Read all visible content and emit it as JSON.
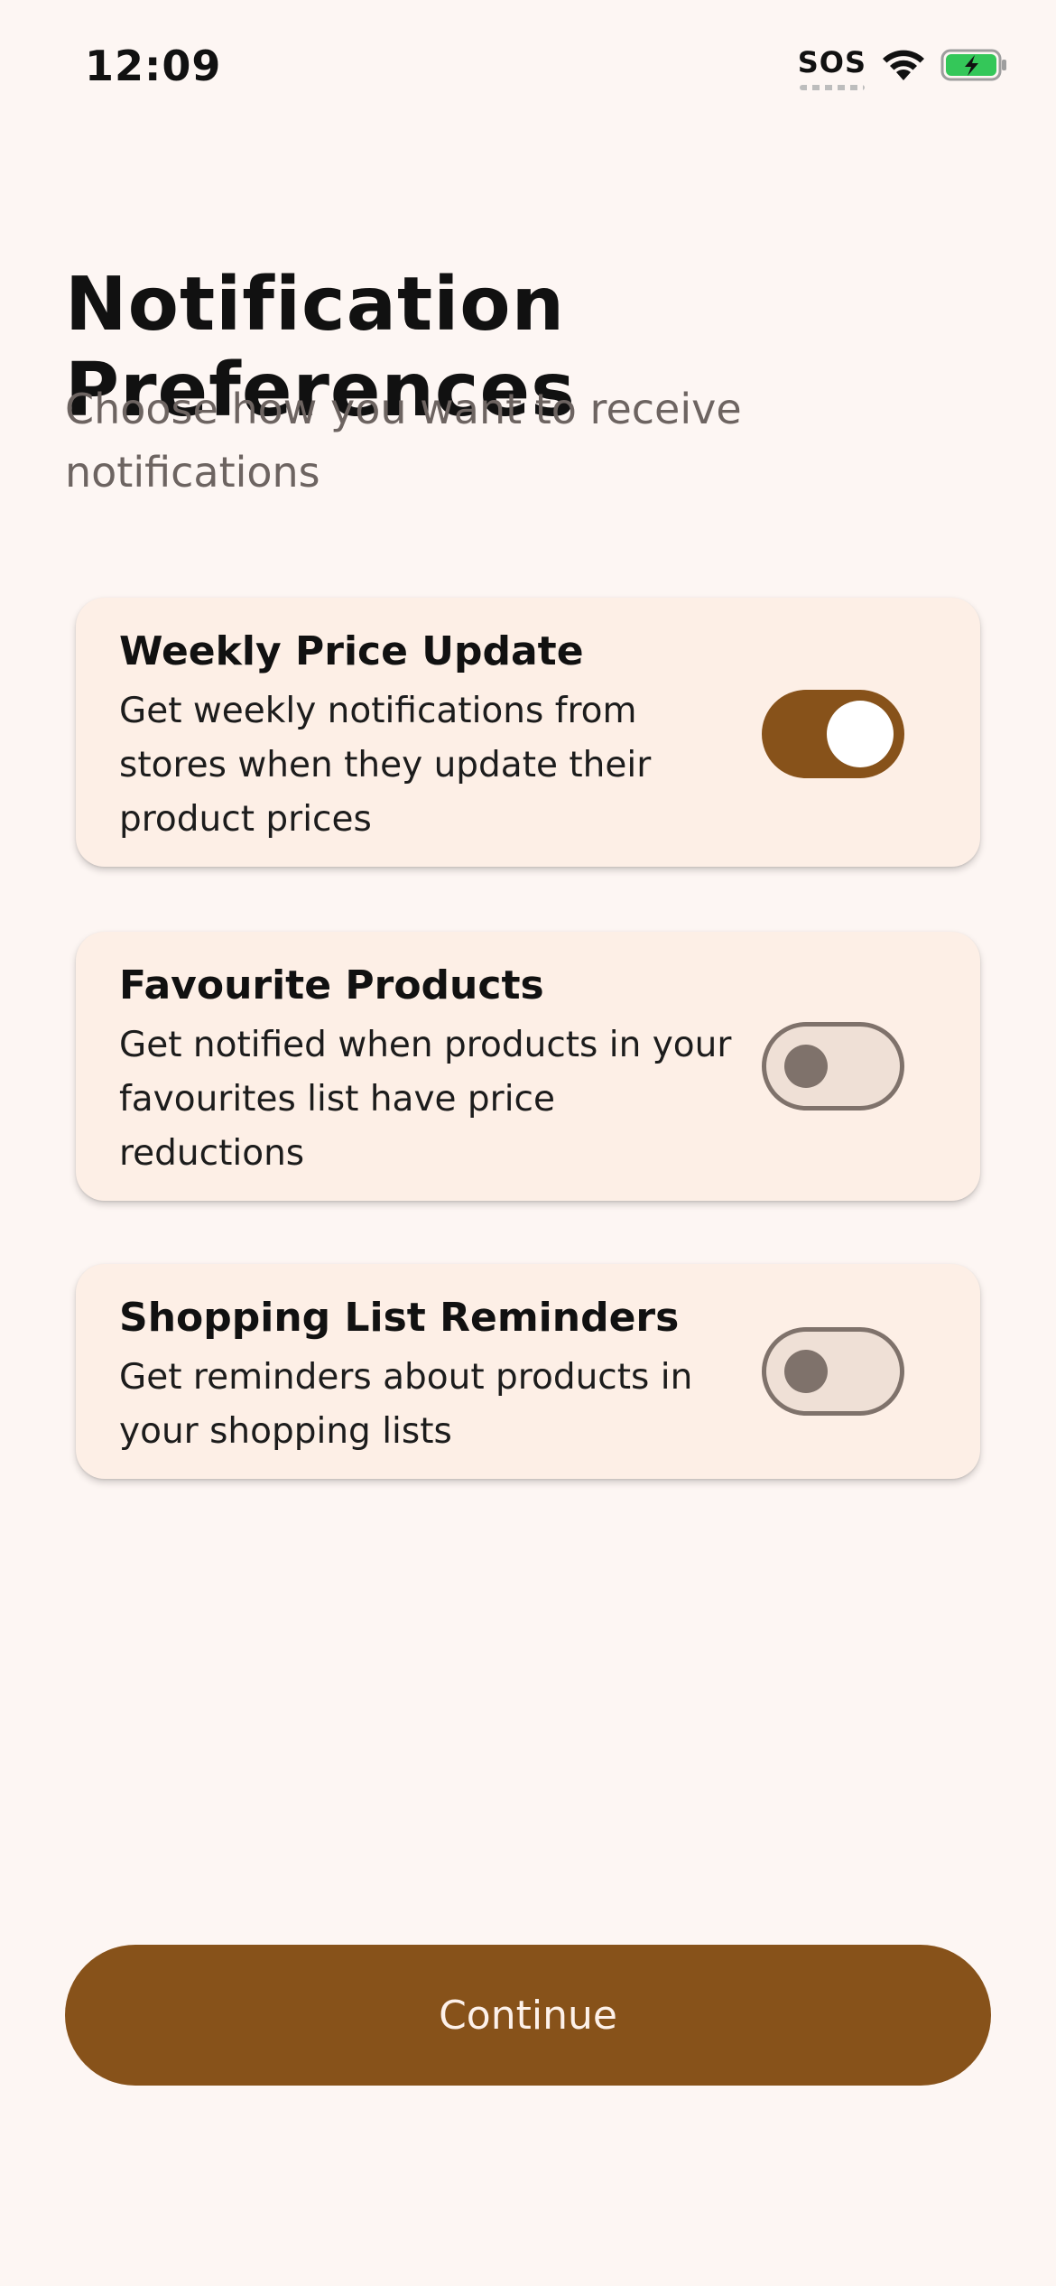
{
  "status_bar": {
    "time": "12:09",
    "sos_label": "SOS",
    "wifi_icon": "wifi-icon",
    "battery_icon": "battery-charging-icon",
    "battery_color": "#34c759"
  },
  "header": {
    "title": "Notification Preferences",
    "subtitle": "Choose how you want to receive notifications"
  },
  "preferences": [
    {
      "title": "Weekly Price Update",
      "description": "Get weekly notifications from stores when they update their product prices",
      "enabled": true
    },
    {
      "title": "Favourite Products",
      "description": "Get notified when products in your favourites list have price reductions",
      "enabled": false
    },
    {
      "title": "Shopping List Reminders",
      "description": "Get reminders about products in your shopping lists",
      "enabled": false
    }
  ],
  "actions": {
    "continue_label": "Continue"
  },
  "colors": {
    "background": "#fdf6f3",
    "card_background": "#fdefe6",
    "accent": "#87521a",
    "toggle_off_track": "#efe0d6",
    "toggle_off_outline": "#7f726b"
  }
}
